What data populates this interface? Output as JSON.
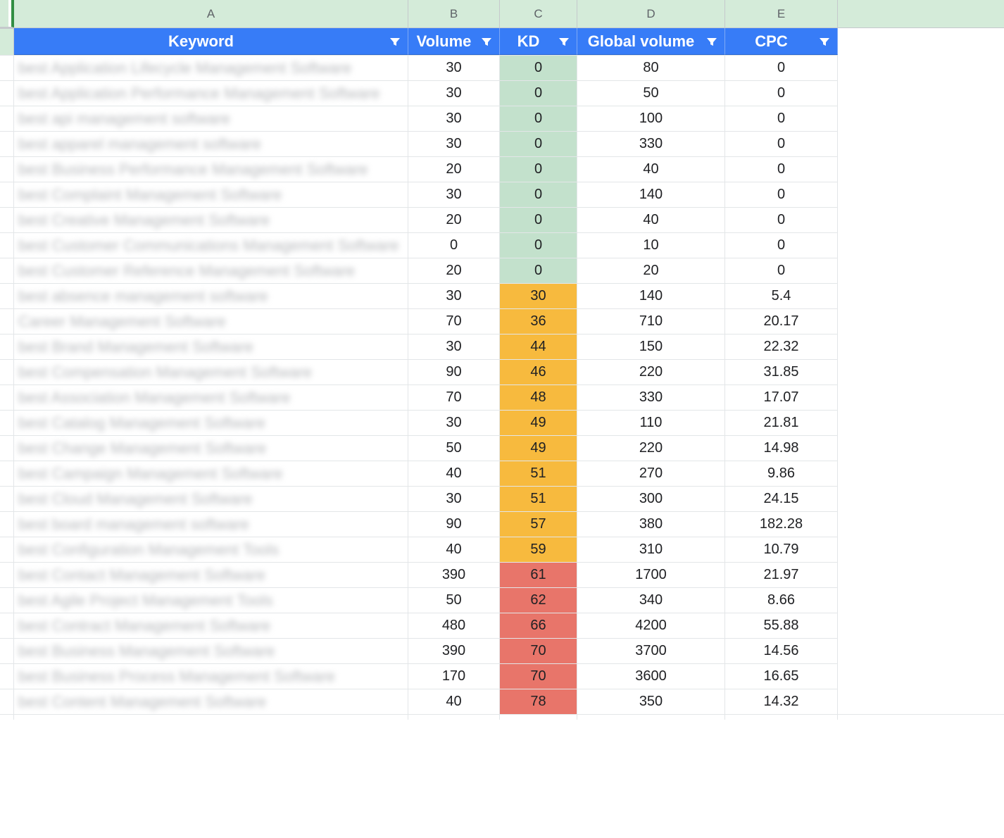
{
  "columns": {
    "letters": [
      "A",
      "B",
      "C",
      "D",
      "E"
    ],
    "headers": [
      "Keyword",
      "Volume",
      "KD",
      "Global volume",
      "CPC"
    ]
  },
  "kd_colors": {
    "green": "#c3e1cc",
    "orange": "#f7ba3e",
    "red": "#e8756a"
  },
  "rows": [
    {
      "keyword": "best Application Lifecycle Management Software",
      "volume": "30",
      "kd": "0",
      "kd_band": "green",
      "global": "80",
      "cpc": "0"
    },
    {
      "keyword": "best Application Performance Management Software",
      "volume": "30",
      "kd": "0",
      "kd_band": "green",
      "global": "50",
      "cpc": "0"
    },
    {
      "keyword": "best api management software",
      "volume": "30",
      "kd": "0",
      "kd_band": "green",
      "global": "100",
      "cpc": "0"
    },
    {
      "keyword": "best apparel management software",
      "volume": "30",
      "kd": "0",
      "kd_band": "green",
      "global": "330",
      "cpc": "0"
    },
    {
      "keyword": "best Business Performance Management Software",
      "volume": "20",
      "kd": "0",
      "kd_band": "green",
      "global": "40",
      "cpc": "0"
    },
    {
      "keyword": "best Complaint Management Software",
      "volume": "30",
      "kd": "0",
      "kd_band": "green",
      "global": "140",
      "cpc": "0"
    },
    {
      "keyword": "best Creative Management Software",
      "volume": "20",
      "kd": "0",
      "kd_band": "green",
      "global": "40",
      "cpc": "0"
    },
    {
      "keyword": "best Customer Communications Management Software",
      "volume": "0",
      "kd": "0",
      "kd_band": "green",
      "global": "10",
      "cpc": "0"
    },
    {
      "keyword": "best Customer Reference Management Software",
      "volume": "20",
      "kd": "0",
      "kd_band": "green",
      "global": "20",
      "cpc": "0"
    },
    {
      "keyword": "best absence management software",
      "volume": "30",
      "kd": "30",
      "kd_band": "orange",
      "global": "140",
      "cpc": "5.4"
    },
    {
      "keyword": "Career Management Software",
      "volume": "70",
      "kd": "36",
      "kd_band": "orange",
      "global": "710",
      "cpc": "20.17"
    },
    {
      "keyword": "best Brand Management Software",
      "volume": "30",
      "kd": "44",
      "kd_band": "orange",
      "global": "150",
      "cpc": "22.32"
    },
    {
      "keyword": "best Compensation Management Software",
      "volume": "90",
      "kd": "46",
      "kd_band": "orange",
      "global": "220",
      "cpc": "31.85"
    },
    {
      "keyword": "best Association Management Software",
      "volume": "70",
      "kd": "48",
      "kd_band": "orange",
      "global": "330",
      "cpc": "17.07"
    },
    {
      "keyword": "best Catalog Management Software",
      "volume": "30",
      "kd": "49",
      "kd_band": "orange",
      "global": "110",
      "cpc": "21.81"
    },
    {
      "keyword": "best Change Management Software",
      "volume": "50",
      "kd": "49",
      "kd_band": "orange",
      "global": "220",
      "cpc": "14.98"
    },
    {
      "keyword": "best Campaign Management Software",
      "volume": "40",
      "kd": "51",
      "kd_band": "orange",
      "global": "270",
      "cpc": "9.86"
    },
    {
      "keyword": "best Cloud Management Software",
      "volume": "30",
      "kd": "51",
      "kd_band": "orange",
      "global": "300",
      "cpc": "24.15"
    },
    {
      "keyword": "best board management software",
      "volume": "90",
      "kd": "57",
      "kd_band": "orange",
      "global": "380",
      "cpc": "182.28"
    },
    {
      "keyword": "best Configuration Management Tools",
      "volume": "40",
      "kd": "59",
      "kd_band": "orange",
      "global": "310",
      "cpc": "10.79"
    },
    {
      "keyword": "best Contact Management Software",
      "volume": "390",
      "kd": "61",
      "kd_band": "red",
      "global": "1700",
      "cpc": "21.97"
    },
    {
      "keyword": "best Agile Project Management Tools",
      "volume": "50",
      "kd": "62",
      "kd_band": "red",
      "global": "340",
      "cpc": "8.66"
    },
    {
      "keyword": "best Contract Management Software",
      "volume": "480",
      "kd": "66",
      "kd_band": "red",
      "global": "4200",
      "cpc": "55.88"
    },
    {
      "keyword": "best Business Management Software",
      "volume": "390",
      "kd": "70",
      "kd_band": "red",
      "global": "3700",
      "cpc": "14.56"
    },
    {
      "keyword": "best Business Process Management Software",
      "volume": "170",
      "kd": "70",
      "kd_band": "red",
      "global": "3600",
      "cpc": "16.65"
    },
    {
      "keyword": "best Content Management Software",
      "volume": "40",
      "kd": "78",
      "kd_band": "red",
      "global": "350",
      "cpc": "14.32"
    }
  ]
}
